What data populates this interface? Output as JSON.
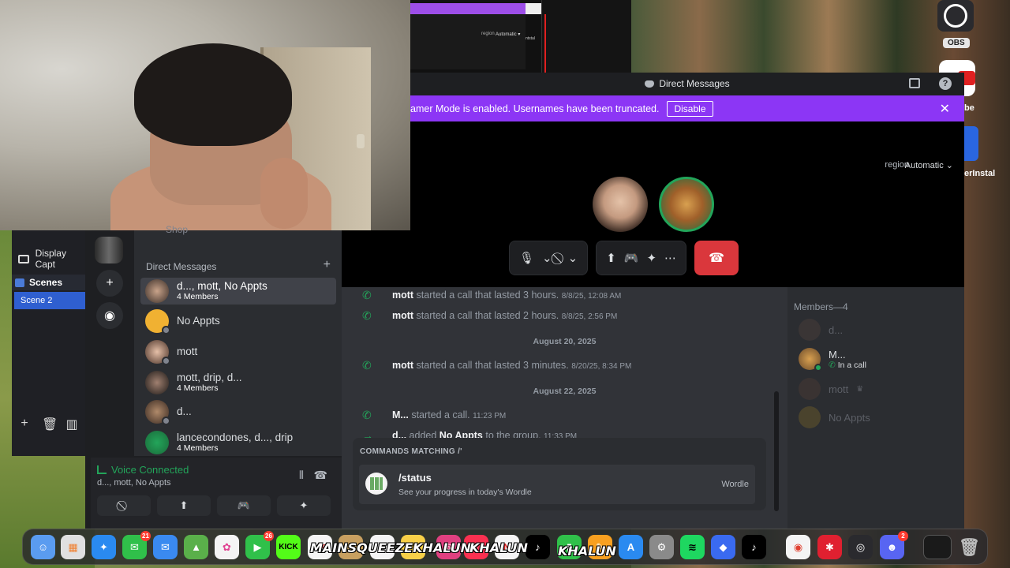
{
  "webcam": {},
  "thumb": {
    "region": "region",
    "auto": "Automatic ▾",
    "install": "ntstal"
  },
  "obs": {
    "source_label": "Display Capt",
    "scenes_label": "Scenes",
    "scene_item": "Scene 2",
    "icon_label": "OBS"
  },
  "desktop": {
    "yt_label": "be",
    "install_label": "erInstal"
  },
  "window": {
    "title": "Direct Messages"
  },
  "banner": {
    "message": "amer Mode is enabled. Usernames have been truncated.",
    "disable_label": "Disable",
    "close_glyph": "✕"
  },
  "call": {
    "region_label": "region",
    "region_value": "Automatic"
  },
  "dm": {
    "shop_label": "Shop",
    "header": "Direct Messages",
    "add_glyph": "+",
    "items": [
      {
        "name": "d..., mott, No Appts",
        "sub": "4 Members"
      },
      {
        "name": "No Appts",
        "sub": ""
      },
      {
        "name": "mott",
        "sub": ""
      },
      {
        "name": "mott, drip, d...",
        "sub": "4 Members"
      },
      {
        "name": "d...",
        "sub": ""
      },
      {
        "name": "lancecondones, d..., drip",
        "sub": "4 Members"
      }
    ]
  },
  "voice": {
    "status": "Voice Connected",
    "channel": "d..., mott, No Appts"
  },
  "chat": {
    "lines": [
      {
        "user": "mott",
        "text": " started a call that lasted 3 hours.",
        "time": "8/8/25, 12:08 AM"
      },
      {
        "user": "mott",
        "text": " started a call that lasted 2 hours.",
        "time": "8/8/25, 2:56 PM"
      },
      {
        "user": "mott",
        "text": " started a call that lasted 3 minutes.",
        "time": "8/20/25, 8:34 PM"
      },
      {
        "user": "M...",
        "text": " started a call.",
        "time": "11:23 PM"
      },
      {
        "user": "d...",
        "text": " added ",
        "target": "No Appts",
        "text2": " to the group.",
        "time": "11:33 PM"
      }
    ],
    "dividers": [
      "August 20, 2025",
      "August 22, 2025"
    ]
  },
  "commands": {
    "header": "COMMANDS MATCHING /'",
    "name": "/status",
    "desc": "See your progress in today's Wordle",
    "app": "Wordle"
  },
  "members": {
    "header": "Members—4",
    "list": [
      {
        "name": "d...",
        "sub": ""
      },
      {
        "name": "M...",
        "sub": "In a call"
      },
      {
        "name": "mott",
        "sub": ""
      },
      {
        "name": "No Appts",
        "sub": ""
      }
    ]
  },
  "dock": {
    "badges": {
      "messages": "21",
      "facetime": "26",
      "discord": "2"
    },
    "overlays": [
      "MAINSQUEEZEKHALUN",
      "KHALUN",
      "KHALUN"
    ],
    "kick": "KICK",
    "calendar": "AUG"
  },
  "colors": {
    "accent": "#8c36f5",
    "online": "#23a55a",
    "danger": "#da373c"
  }
}
